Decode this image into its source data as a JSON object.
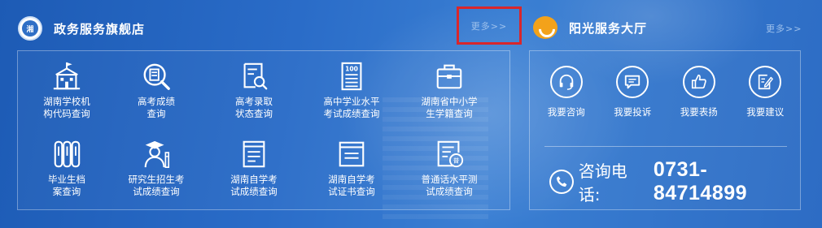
{
  "left": {
    "title": "政务服务旗舰店",
    "more": "更多>>",
    "emblem_text": "湘",
    "items": [
      {
        "label": "湖南学校机构代码查询",
        "icon": "school-building-icon"
      },
      {
        "label": "高考成绩查询",
        "icon": "magnifier-document-icon"
      },
      {
        "label": "高考录取状态查询",
        "icon": "search-document-icon"
      },
      {
        "label": "高中学业水平考试成绩查询",
        "icon": "score-100-icon"
      },
      {
        "label": "湖南省中小学生学籍查询",
        "icon": "briefcase-icon"
      },
      {
        "label": "毕业生档案查询",
        "icon": "archive-binders-icon"
      },
      {
        "label": "研究生招生考试成绩查询",
        "icon": "graduate-icon"
      },
      {
        "label": "湖南自学考试成绩查询",
        "icon": "exam-book-icon"
      },
      {
        "label": "湖南自学考试证书查询",
        "icon": "certificate-icon"
      },
      {
        "label": "普通话水平测试成绩查询",
        "icon": "mandarin-test-icon"
      }
    ]
  },
  "right": {
    "title": "阳光服务大厅",
    "more": "更多>>",
    "services": [
      {
        "label": "我要咨询",
        "icon": "headset-icon"
      },
      {
        "label": "我要投诉",
        "icon": "chat-icon"
      },
      {
        "label": "我要表扬",
        "icon": "thumbs-up-icon"
      },
      {
        "label": "我要建议",
        "icon": "edit-icon"
      }
    ],
    "hotline": {
      "label": "咨询电话:",
      "number": "0731-84714899"
    }
  }
}
